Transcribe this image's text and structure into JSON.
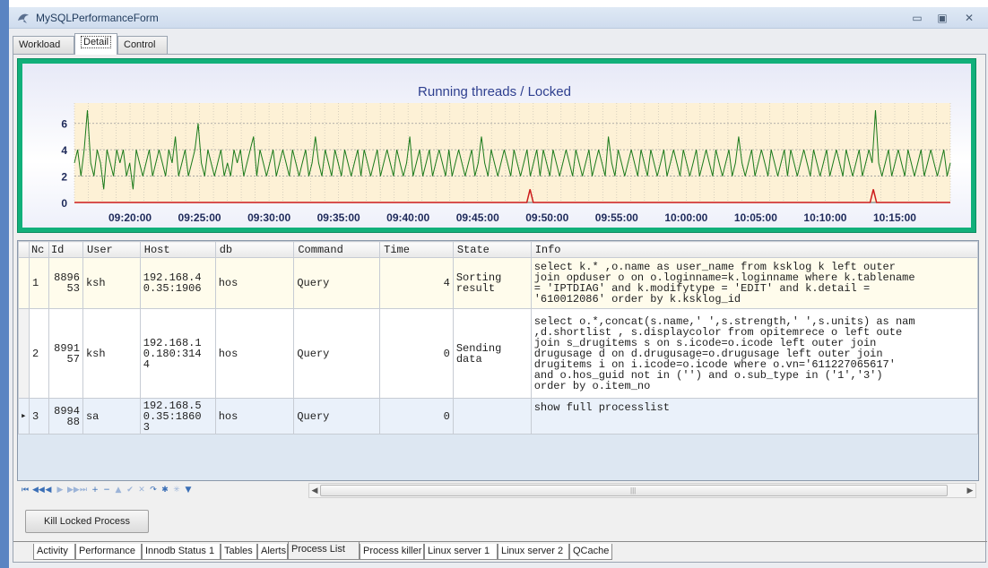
{
  "window": {
    "title": "MySQLPerformanceForm",
    "minimize_glyph": "▭",
    "maximize_glyph": "▣",
    "close_glyph": "✕",
    "icon": "dolphin-icon"
  },
  "top_tabs": [
    {
      "label": "Workload"
    },
    {
      "label": "Detail"
    },
    {
      "label": "Control"
    }
  ],
  "chart_data": {
    "type": "line",
    "title": "Running threads / Locked",
    "x_ticks": [
      "09:20:00",
      "09:25:00",
      "09:30:00",
      "09:35:00",
      "09:40:00",
      "09:45:00",
      "09:50:00",
      "09:55:00",
      "10:00:00",
      "10:05:00",
      "10:10:00",
      "10:15:00"
    ],
    "x_range": [
      "09:16:00",
      "10:19:00"
    ],
    "y_ticks": [
      0,
      2,
      4,
      6
    ],
    "ylim": [
      0,
      7
    ],
    "grid": true,
    "background_color": "#fdf1d6",
    "series": [
      {
        "color": "#1a7a1a",
        "values": [
          3,
          4,
          2,
          4,
          7,
          3,
          2,
          4,
          3,
          1,
          4,
          3,
          2,
          4,
          3,
          4,
          2,
          3,
          1,
          4,
          3,
          2,
          3,
          4,
          2,
          3,
          4,
          3,
          2,
          4,
          3,
          5,
          2,
          3,
          4,
          2,
          3,
          4,
          6,
          3,
          2,
          4,
          3,
          2,
          3,
          4,
          2,
          3,
          2,
          4,
          3,
          4,
          2,
          3,
          4,
          5,
          2,
          4,
          3,
          2,
          3,
          4,
          2,
          3,
          4,
          3,
          2,
          4,
          3,
          2,
          3,
          4,
          2,
          3,
          5,
          3,
          2,
          4,
          3,
          2,
          4,
          3,
          2,
          4,
          3,
          2,
          3,
          4,
          2,
          4,
          3,
          2,
          3,
          4,
          2,
          3,
          4,
          3,
          2,
          4,
          3,
          2,
          3,
          5,
          2,
          3,
          4,
          2,
          3,
          4,
          2,
          3,
          4,
          3,
          2,
          4,
          2,
          3,
          4,
          3,
          2,
          3,
          4,
          2,
          3,
          5,
          3,
          2,
          4,
          3,
          2,
          3,
          4,
          3,
          2,
          4,
          3,
          2,
          3,
          4,
          2,
          3,
          4,
          2,
          4,
          3,
          2,
          4,
          3,
          2,
          3,
          4,
          3,
          2,
          4,
          3,
          2,
          3,
          4,
          2,
          3,
          4,
          3,
          2,
          5,
          3,
          2,
          4,
          3,
          2,
          3,
          4,
          3,
          2,
          4,
          3,
          2,
          4,
          3,
          2,
          3,
          4,
          2,
          3,
          4,
          3,
          2,
          4,
          3,
          2,
          3,
          4,
          2,
          3,
          4,
          3,
          2,
          4,
          3,
          2,
          3,
          4,
          2,
          3,
          5,
          3,
          2,
          3,
          4,
          2,
          3,
          4,
          3,
          2,
          4,
          3,
          2,
          3,
          4,
          2,
          4,
          3,
          2,
          3,
          4,
          3,
          2,
          4,
          3,
          2,
          3,
          4,
          2,
          3,
          4,
          3,
          2,
          4,
          3,
          2,
          3,
          4,
          2,
          3,
          4,
          3,
          7,
          3,
          2,
          3,
          4,
          2,
          3,
          4,
          3,
          2,
          4,
          3,
          2,
          3,
          4,
          2,
          3,
          4,
          3,
          2,
          3,
          4,
          2,
          3
        ]
      },
      {
        "color": "#cc1b1b",
        "values": [
          0,
          0,
          0,
          0,
          0,
          0,
          0,
          0,
          0,
          0,
          0,
          0,
          0,
          0,
          0,
          0,
          0,
          0,
          0,
          0,
          0,
          0,
          0,
          0,
          0,
          0,
          0,
          0,
          0,
          0,
          0,
          0,
          0,
          0,
          0,
          0,
          0,
          0,
          0,
          0,
          0,
          0,
          0,
          0,
          0,
          0,
          0,
          0,
          0,
          0,
          0,
          0,
          0,
          0,
          0,
          0,
          0,
          0,
          0,
          0,
          0,
          0,
          0,
          0,
          0,
          0,
          0,
          0,
          0,
          0,
          0,
          0,
          0,
          0,
          0,
          0,
          0,
          0,
          0,
          0,
          0,
          0,
          0,
          0,
          0,
          0,
          0,
          0,
          0,
          0,
          0,
          0,
          0,
          0,
          0,
          0,
          0,
          0,
          0,
          0,
          0,
          0,
          0,
          0,
          0,
          0,
          0,
          0,
          0,
          0,
          0,
          0,
          0,
          0,
          0,
          0,
          0,
          0,
          0,
          0,
          0,
          0,
          0,
          0,
          0,
          0,
          0,
          0,
          0,
          0,
          0,
          0,
          0,
          0,
          0,
          0,
          0,
          0,
          0,
          0,
          0,
          0,
          1,
          0,
          0,
          0,
          0,
          0,
          0,
          0,
          0,
          0,
          0,
          0,
          0,
          0,
          0,
          0,
          0,
          0,
          0,
          0,
          0,
          0,
          0,
          0,
          0,
          0,
          0,
          0,
          0,
          0,
          0,
          0,
          0,
          0,
          0,
          0,
          0,
          0,
          0,
          0,
          0,
          0,
          0,
          0,
          0,
          0,
          0,
          0,
          0,
          0,
          0,
          0,
          0,
          0,
          0,
          0,
          0,
          0,
          0,
          0,
          0,
          0,
          0,
          0,
          0,
          0,
          0,
          0,
          0,
          0,
          0,
          0,
          0,
          0,
          0,
          0,
          0,
          0,
          0,
          0,
          0,
          0,
          0,
          0,
          0,
          0,
          0,
          0,
          0,
          0,
          0,
          0,
          0,
          0,
          0,
          0,
          0,
          0,
          0,
          0,
          0,
          0,
          0,
          0,
          0,
          0,
          0,
          1,
          0,
          0,
          0,
          0,
          0,
          0,
          0,
          0,
          0,
          0,
          0,
          0,
          0,
          0,
          0,
          0,
          0,
          0,
          0,
          0,
          0,
          0,
          0,
          0
        ]
      }
    ]
  },
  "grid": {
    "columns": [
      "Nc",
      "Id",
      "User",
      "Host",
      "db",
      "Command",
      "Time",
      "State",
      "Info"
    ],
    "rows": [
      {
        "current": false,
        "nc": "1",
        "id": "8896\n53",
        "user": "ksh",
        "host": "192.168.4\n0.35:1906",
        "db": "hos",
        "command": "Query",
        "time": "4",
        "state": "Sorting\nresult",
        "info": "select k.* ,o.name as user_name  from ksklog  k  left outer\njoin opduser o on o.loginname=k.loginname  where k.tablename\n= 'IPTDIAG' and k.modifytype = 'EDIT'  and k.detail =\n'610012086'  order by k.ksklog_id"
      },
      {
        "current": false,
        "nc": "2",
        "id": "8991\n57",
        "user": "ksh",
        "host": "192.168.1\n0.180:314\n4",
        "db": "hos",
        "command": "Query",
        "time": "0",
        "state": "Sending\ndata",
        "info": "select o.*,concat(s.name,' ',s.strength,' ',s.units)  as nam\n,d.shortlist  , s.displaycolor  from opitemrece o  left oute\njoin s_drugitems s on s.icode=o.icode  left outer join\ndrugusage d on d.drugusage=o.drugusage  left outer join\ndrugitems i on i.icode=o.icode  where o.vn='611227065617'\nand o.hos_guid not in ('')  and o.sub_type in ('1','3')\norder by o.item_no"
      },
      {
        "current": true,
        "nc": "3",
        "id": "8994\n88",
        "user": "sa",
        "host": "192.168.5\n0.35:1860\n3",
        "db": "hos",
        "command": "Query",
        "time": "0",
        "state": "",
        "info": "show full processlist"
      }
    ],
    "splitter": "....",
    "scroll_mark": "|||"
  },
  "navigator": {
    "buttons": [
      "first-icon",
      "prev-page-icon",
      "prev-icon",
      "next-icon",
      "next-page-icon",
      "last-icon",
      "insert-icon",
      "delete-icon",
      "edit-icon",
      "post-icon",
      "cancel-icon",
      "refresh-icon",
      "save-bookmark-icon",
      "goto-bookmark-icon",
      "filter-icon"
    ],
    "glyphs": [
      "⏮",
      "◀◀",
      "◀",
      "▶",
      "▶▶",
      "⏭",
      "+",
      "−",
      "▲",
      "✔",
      "✕",
      "↷",
      "✱",
      "✳",
      "▼"
    ]
  },
  "actions": {
    "kill_label": "Kill Locked Process"
  },
  "bottom_tabs": [
    {
      "label": "Activity"
    },
    {
      "label": "Performance"
    },
    {
      "label": "Innodb Status 1"
    },
    {
      "label": "Tables"
    },
    {
      "label": "Alerts"
    },
    {
      "label": "Process List"
    },
    {
      "label": "Process killer"
    },
    {
      "label": "Linux server 1"
    },
    {
      "label": "Linux server 2"
    },
    {
      "label": "QCache"
    }
  ]
}
